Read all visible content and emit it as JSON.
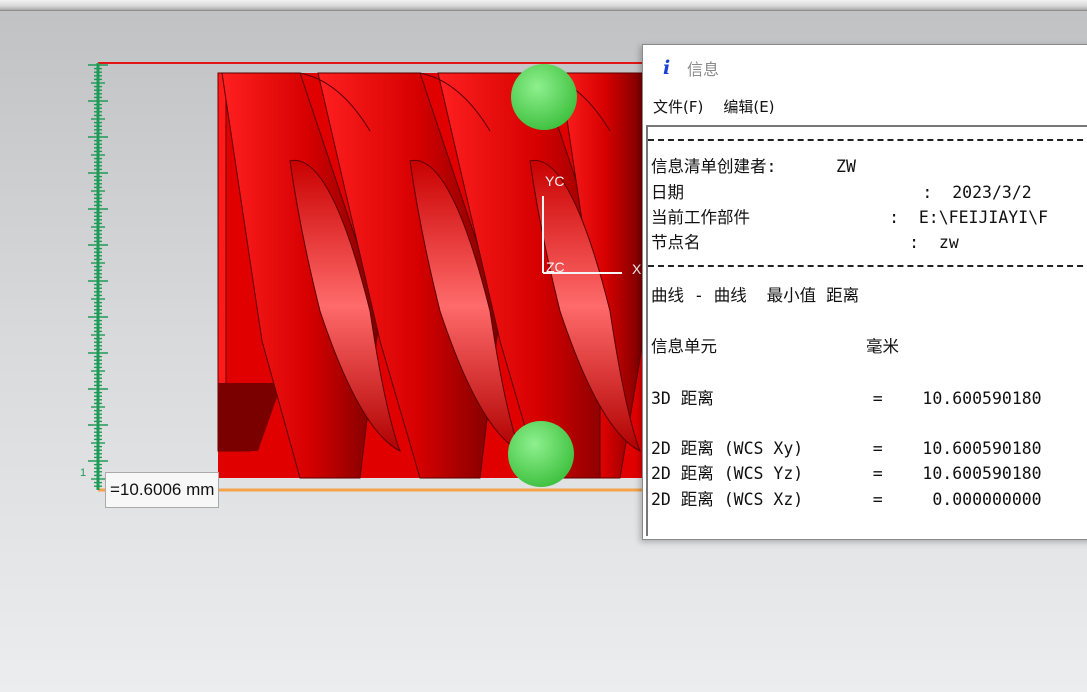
{
  "viewport": {
    "measurement_label": "=10.6006 mm",
    "ruler_number": "1",
    "axis_labels": {
      "yc": "YC",
      "zc": "ZC",
      "xc": "X"
    }
  },
  "info_window": {
    "icon": "info-icon",
    "title": "信息",
    "menu": {
      "file": "文件(F)",
      "edit": "编辑(E)"
    },
    "lines": {
      "creator": "信息清单创建者:      ZW",
      "date": "日期                        :  2023/3/2",
      "current_part": "当前工作部件              :  E:\\FEIJIAYI\\F",
      "node_name": "节点名                     :  zw",
      "curve_header": "曲线 - 曲线  最小值 距离",
      "unit_header": "信息单元               毫米",
      "dist_3d": "3D 距离                =    10.600590180",
      "dist_2d_xy": "2D 距离 (WCS Xy)       =    10.600590180",
      "dist_2d_yz": "2D 距离 (WCS Yz)       =    10.600590180",
      "dist_2d_xz": "2D 距离 (WCS Xz)       =     0.000000000"
    }
  },
  "colors": {
    "thread_red": "#ff1a1a",
    "dark_red": "#8c0000",
    "ruler_green": "#1e9a57",
    "ball_green": "#5fde5f",
    "line_orange": "#f5a24a",
    "line_red": "#e01515"
  }
}
